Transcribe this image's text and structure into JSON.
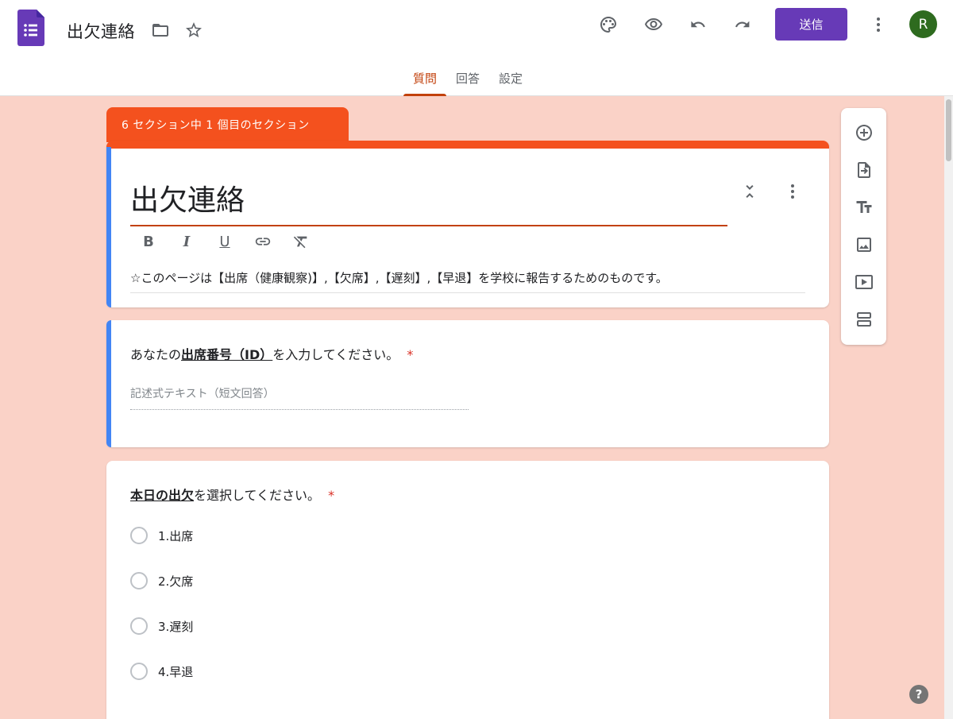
{
  "header": {
    "title": "出欠連絡",
    "send_label": "送信",
    "avatar_initial": "R",
    "icons": [
      "forms-logo-icon",
      "folder-icon",
      "star-icon",
      "palette-icon",
      "preview-eye-icon",
      "undo-icon",
      "redo-icon",
      "more-vert-icon"
    ]
  },
  "tabs": [
    {
      "label": "質問",
      "active": true
    },
    {
      "label": "回答",
      "active": false
    },
    {
      "label": "設定",
      "active": false
    }
  ],
  "section": {
    "tag": "6 セクション中 1 個目のセクション"
  },
  "form": {
    "title": "出欠連絡",
    "description": "☆このページは【出席（健康観察)】,【欠席】,【遅刻】,【早退】を学校に報告するためのものです。",
    "format_buttons": [
      "B",
      "I",
      "U"
    ]
  },
  "q1": {
    "prefix": "あなたの",
    "emphasis": "出席番号（ID）",
    "suffix": "を入力してください。",
    "required_mark": "*",
    "placeholder": "記述式テキスト（短文回答）"
  },
  "q2": {
    "emphasis": "本日の出欠",
    "suffix": "を選択してください。",
    "required_mark": "*",
    "options": [
      "1.出席",
      "2.欠席",
      "3.遅刻",
      "4.早退"
    ]
  },
  "help": "?",
  "colors": {
    "accent": "#f4511e",
    "background": "#fad2c7",
    "send_button": "#673ab7",
    "active_tab": "#c2410c",
    "focus_bar": "#4285f4",
    "avatar": "#2e6b1f"
  }
}
